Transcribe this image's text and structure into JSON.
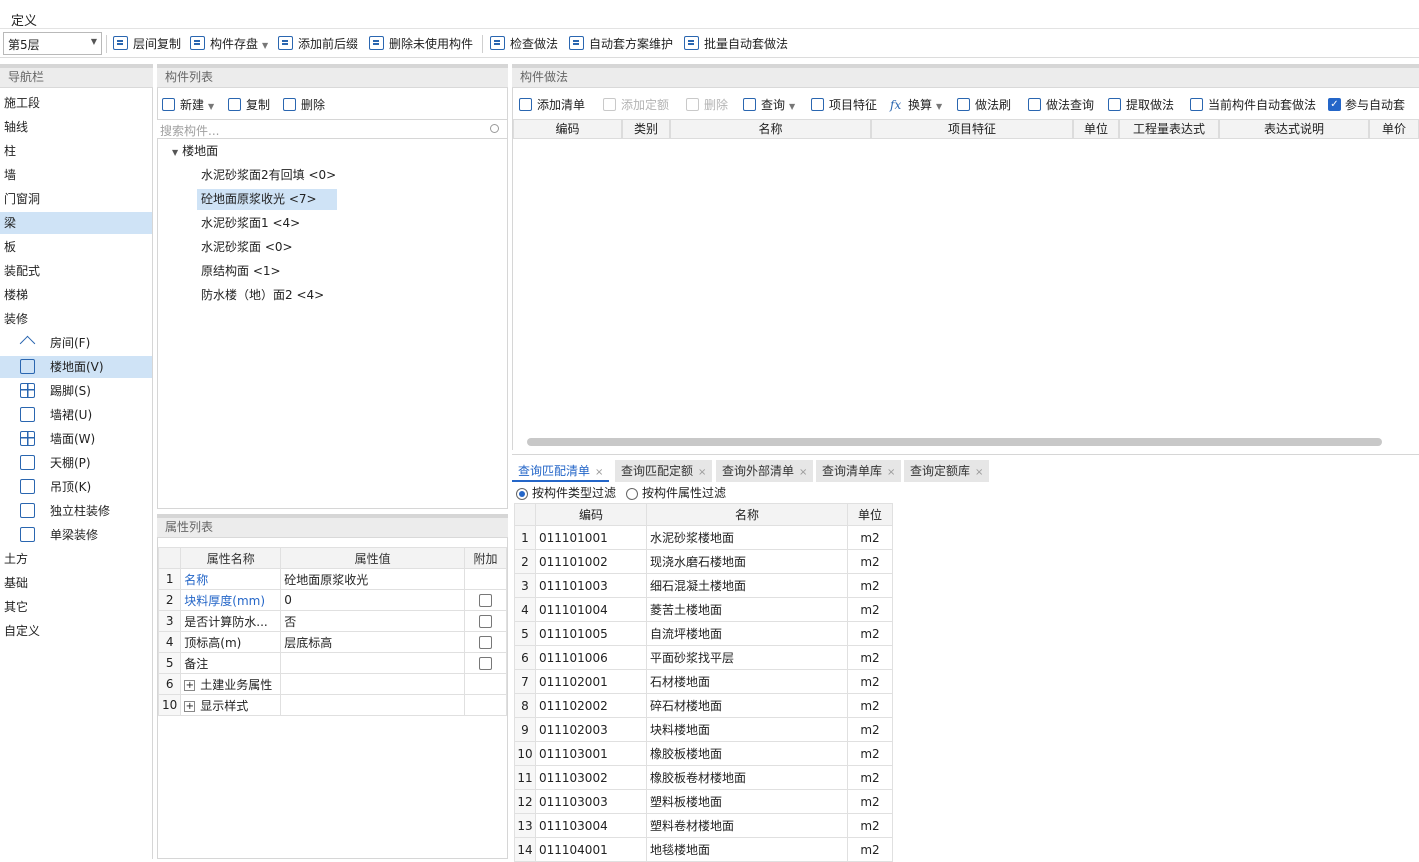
{
  "menu": {
    "title": "定义"
  },
  "toolbar": {
    "floor": "第5层",
    "buttons": [
      "层间复制",
      "构件存盘",
      "添加前后缀",
      "删除未使用构件",
      "检查做法",
      "自动套方案维护",
      "批量自动套做法"
    ]
  },
  "nav": {
    "header": "导航栏",
    "items": [
      "施工段",
      "轴线",
      "柱",
      "墙",
      "门窗洞",
      "梁",
      "板",
      "装配式",
      "楼梯",
      "装修"
    ],
    "selected": "梁",
    "sub_items": [
      "房间(F)",
      "楼地面(V)",
      "踢脚(S)",
      "墙裙(U)",
      "墙面(W)",
      "天棚(P)",
      "吊顶(K)",
      "独立柱装修",
      "单梁装修"
    ],
    "sub_selected": "楼地面(V)",
    "bottom_items": [
      "土方",
      "基础",
      "其它",
      "自定义"
    ]
  },
  "components": {
    "header": "构件列表",
    "toolbar": {
      "new": "新建",
      "copy": "复制",
      "delete": "删除"
    },
    "search_placeholder": "搜索构件...",
    "tree_root": "楼地面",
    "items": [
      "水泥砂浆面2有回填 <0>",
      "砼地面原浆收光 <7>",
      "水泥砂浆面1 <4>",
      "水泥砂浆面 <0>",
      "原结构面 <1>",
      "防水楼（地）面2 <4>"
    ],
    "selected": "砼地面原浆收光 <7>"
  },
  "props": {
    "header": "属性列表",
    "columns": [
      "属性名称",
      "属性值",
      "附加"
    ],
    "rows": [
      {
        "n": "1",
        "name": "名称",
        "value": "砼地面原浆收光"
      },
      {
        "n": "2",
        "name": "块料厚度(mm)",
        "value": "0"
      },
      {
        "n": "3",
        "name": "是否计算防水...",
        "value": "否"
      },
      {
        "n": "4",
        "name": "顶标高(m)",
        "value": "层底标高"
      },
      {
        "n": "5",
        "name": "备注",
        "value": ""
      },
      {
        "n": "6",
        "name": "土建业务属性",
        "value": ""
      },
      {
        "n": "10",
        "name": "显示样式",
        "value": ""
      }
    ]
  },
  "method": {
    "header": "构件做法",
    "toolbar": [
      "添加清单",
      "添加定额",
      "删除",
      "查询",
      "项目特征",
      "换算",
      "做法刷",
      "做法查询",
      "提取做法",
      "当前构件自动套做法",
      "参与自动套"
    ],
    "columns": [
      "编码",
      "类别",
      "名称",
      "项目特征",
      "单位",
      "工程量表达式",
      "表达式说明",
      "单价"
    ]
  },
  "query": {
    "tabs": [
      "查询匹配清单",
      "查询匹配定额",
      "查询外部清单",
      "查询清单库",
      "查询定额库"
    ],
    "filter_type": "按构件类型过滤",
    "filter_attr": "按构件属性过滤",
    "columns": [
      "编码",
      "名称",
      "单位"
    ],
    "rows": [
      {
        "n": "1",
        "code": "011101001",
        "name": "水泥砂浆楼地面",
        "unit": "m2"
      },
      {
        "n": "2",
        "code": "011101002",
        "name": "现浇水磨石楼地面",
        "unit": "m2"
      },
      {
        "n": "3",
        "code": "011101003",
        "name": "细石混凝土楼地面",
        "unit": "m2"
      },
      {
        "n": "4",
        "code": "011101004",
        "name": "菱苦土楼地面",
        "unit": "m2"
      },
      {
        "n": "5",
        "code": "011101005",
        "name": "自流坪楼地面",
        "unit": "m2"
      },
      {
        "n": "6",
        "code": "011101006",
        "name": "平面砂浆找平层",
        "unit": "m2"
      },
      {
        "n": "7",
        "code": "011102001",
        "name": "石材楼地面",
        "unit": "m2"
      },
      {
        "n": "8",
        "code": "011102002",
        "name": "碎石材楼地面",
        "unit": "m2"
      },
      {
        "n": "9",
        "code": "011102003",
        "name": "块料楼地面",
        "unit": "m2"
      },
      {
        "n": "10",
        "code": "011103001",
        "name": "橡胶板楼地面",
        "unit": "m2"
      },
      {
        "n": "11",
        "code": "011103002",
        "name": "橡胶板卷材楼地面",
        "unit": "m2"
      },
      {
        "n": "12",
        "code": "011103003",
        "name": "塑料板楼地面",
        "unit": "m2"
      },
      {
        "n": "13",
        "code": "011103004",
        "name": "塑料卷材楼地面",
        "unit": "m2"
      },
      {
        "n": "14",
        "code": "011104001",
        "name": "地毯楼地面",
        "unit": "m2"
      }
    ]
  }
}
